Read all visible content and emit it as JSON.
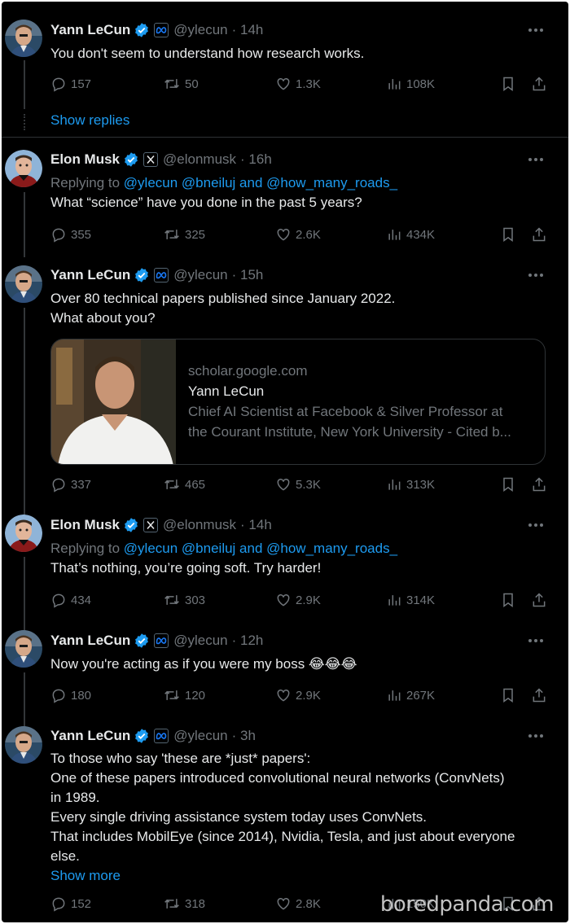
{
  "colors": {
    "background": "#000000",
    "text": "#e7e9ea",
    "muted": "#71767b",
    "accent": "#1d9bf0",
    "border": "#2f3336"
  },
  "icons": [
    "reply-icon",
    "retweet-icon",
    "like-icon",
    "views-icon",
    "bookmark-icon",
    "share-icon",
    "verified-badge-icon",
    "meta-affiliation-icon",
    "x-affiliation-icon",
    "more-icon"
  ],
  "tweets": [
    {
      "name": "Yann LeCun",
      "handle": "@ylecun",
      "time": "· 14h",
      "lines": [
        "You don't seem to understand how research works."
      ],
      "replies": "157",
      "retweets": "50",
      "likes": "1.3K",
      "views": "108K"
    },
    {
      "show_replies": "Show replies"
    },
    {
      "name": "Elon Musk",
      "handle": "@elonmusk",
      "time": "· 16h",
      "replying_prefix": "Replying to",
      "replying_to": "@ylecun @bneiluj and @how_many_roads_",
      "lines": [
        "What “science” have you done in the past 5 years?"
      ],
      "replies": "355",
      "retweets": "325",
      "likes": "2.6K",
      "views": "434K"
    },
    {
      "name": "Yann LeCun",
      "handle": "@ylecun",
      "time": "· 15h",
      "lines": [
        "Over 80 technical papers published since January 2022.",
        "What about you?"
      ],
      "card": {
        "domain": "scholar.google.com",
        "title": "Yann LeCun",
        "desc_line1": "Chief AI Scientist at Facebook & Silver Professor at",
        "desc_line2": "the Courant Institute, New York University - Cited b..."
      },
      "replies": "337",
      "retweets": "465",
      "likes": "5.3K",
      "views": "313K"
    },
    {
      "name": "Elon Musk",
      "handle": "@elonmusk",
      "time": "· 14h",
      "replying_prefix": "Replying to",
      "replying_to": "@ylecun @bneiluj and @how_many_roads_",
      "lines": [
        "That’s nothing, you’re going soft. Try harder!"
      ],
      "replies": "434",
      "retweets": "303",
      "likes": "2.9K",
      "views": "314K"
    },
    {
      "name": "Yann LeCun",
      "handle": "@ylecun",
      "time": "· 12h",
      "lines": [
        "Now you're acting as if you were my boss 😂😂😂"
      ],
      "replies": "180",
      "retweets": "120",
      "likes": "2.9K",
      "views": "267K"
    },
    {
      "name": "Yann LeCun",
      "handle": "@ylecun",
      "time": "· 3h",
      "lines": [
        "To those who say 'these are *just* papers':",
        "One of these papers introduced convolutional neural networks (ConvNets)",
        "in 1989.",
        "Every single driving assistance system today uses ConvNets.",
        "That includes MobilEye (since 2014), Nvidia, Tesla, and just about everyone",
        "else."
      ],
      "show_more": "Show more",
      "replies": "152",
      "retweets": "318",
      "likes": "2.8K",
      "views": "150K"
    }
  ],
  "watermark": "boredpanda.com"
}
